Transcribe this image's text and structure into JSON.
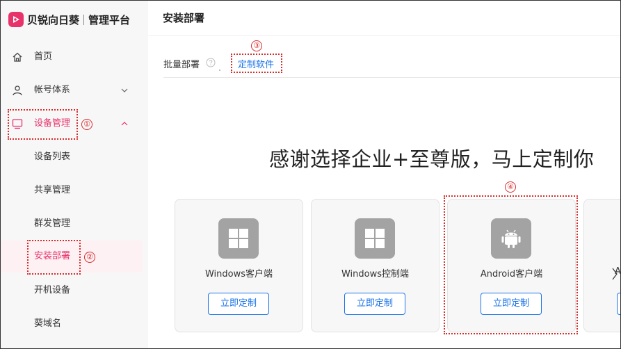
{
  "brand": {
    "name": "贝锐向日葵",
    "subtitle": "管理平台",
    "accent": "#e8336a"
  },
  "sidebar": {
    "items": [
      {
        "label": "首页",
        "icon": "home-icon"
      },
      {
        "label": "帐号体系",
        "icon": "user-icon"
      },
      {
        "label": "设备管理",
        "icon": "monitor-icon"
      }
    ],
    "sub_items": [
      {
        "label": "设备列表"
      },
      {
        "label": "共享管理"
      },
      {
        "label": "群发管理"
      },
      {
        "label": "安装部署"
      },
      {
        "label": "开机设备"
      },
      {
        "label": "葵域名"
      }
    ]
  },
  "header": {
    "title": "安装部署"
  },
  "tabs": {
    "batch": "批量部署",
    "custom": "定制软件"
  },
  "main": {
    "headline": "感谢选择企业+至尊版，马上定制你",
    "cards": [
      {
        "name": "Windows客户端",
        "button": "立即定制",
        "icon": "windows-icon"
      },
      {
        "name": "Windows控制端",
        "button": "立即定制",
        "icon": "windows-icon"
      },
      {
        "name": "Android客户端",
        "button": "立即定制",
        "icon": "android-icon"
      }
    ],
    "partial_card_letter": "A"
  },
  "annotations": [
    "①",
    "②",
    "③",
    "④"
  ],
  "colors": {
    "link": "#1a73e8",
    "annotation": "#d62c2c",
    "icon_tile": "#a3a3a3"
  }
}
